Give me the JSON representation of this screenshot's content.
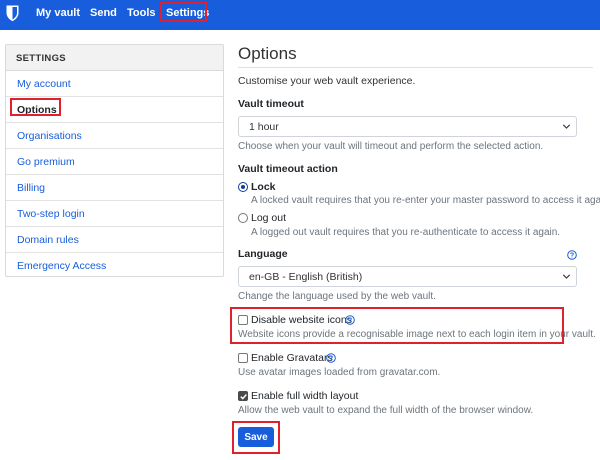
{
  "nav": {
    "items": [
      "My vault",
      "Send",
      "Tools",
      "Settings"
    ]
  },
  "sidebar": {
    "header": "SETTINGS",
    "items": [
      {
        "label": "My account"
      },
      {
        "label": "Options"
      },
      {
        "label": "Organisations"
      },
      {
        "label": "Go premium"
      },
      {
        "label": "Billing"
      },
      {
        "label": "Two-step login"
      },
      {
        "label": "Domain rules"
      },
      {
        "label": "Emergency Access"
      }
    ],
    "active": "Options"
  },
  "main": {
    "title": "Options",
    "subtitle": "Customise your web vault experience.",
    "vault_timeout": {
      "label": "Vault timeout",
      "value": "1 hour",
      "help": "Choose when your vault will timeout and perform the selected action."
    },
    "timeout_action": {
      "label": "Vault timeout action",
      "options": [
        {
          "label": "Lock",
          "help": "A locked vault requires that you re-enter your master password to access it again.",
          "checked": true
        },
        {
          "label": "Log out",
          "help": "A logged out vault requires that you re-authenticate to access it again.",
          "checked": false
        }
      ]
    },
    "language": {
      "label": "Language",
      "value": "en-GB - English (British)",
      "help": "Change the language used by the web vault."
    },
    "disable_icons": {
      "label": "Disable website icons",
      "help": "Website icons provide a recognisable image next to each login item in your vault.",
      "checked": false
    },
    "gravatars": {
      "label": "Enable Gravatars",
      "help": "Use avatar images loaded from gravatar.com.",
      "checked": false
    },
    "full_width": {
      "label": "Enable full width layout",
      "help": "Allow the web vault to expand the full width of the browser window.",
      "checked": true
    },
    "save_label": "Save"
  },
  "colors": {
    "brand": "#175ddc",
    "highlight": "#e0202d"
  }
}
